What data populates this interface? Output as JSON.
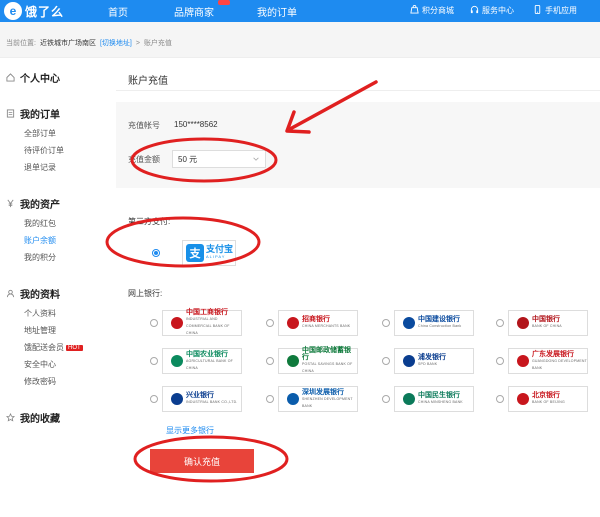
{
  "header": {
    "logo_text": "饿了么",
    "nav": [
      "首页",
      "品牌商家",
      "我的订单"
    ],
    "right": [
      "积分商城",
      "服务中心",
      "手机应用"
    ]
  },
  "breadcrumb": {
    "prefix": "当前位置:",
    "location": "近铁城市广场南区",
    "switch": "[切换地址]",
    "sep": ">",
    "current": "账户充值"
  },
  "sidebar": {
    "sections": [
      {
        "title": "个人中心",
        "icon": "home-icon",
        "items": []
      },
      {
        "title": "我的订单",
        "icon": "order-icon",
        "items": [
          "全部订单",
          "待评价订单",
          "退单记录"
        ]
      },
      {
        "title": "我的资产",
        "icon": "yen-icon",
        "items": [
          "我的红包",
          "账户余额",
          "我的积分"
        ]
      },
      {
        "title": "我的资料",
        "icon": "user-icon",
        "items": [
          "个人资料",
          "地址管理",
          "饿配送会员",
          "安全中心",
          "修改密码"
        ]
      },
      {
        "title": "我的收藏",
        "icon": "star-icon",
        "items": []
      }
    ],
    "active_item": "账户余额",
    "hot_badge": "HOT"
  },
  "main": {
    "title": "账户充值",
    "account_label": "充值帐号",
    "account_value": "150****8562",
    "amount_label": "充值金额",
    "amount_value": "50 元",
    "third_party_label": "第三方支付:",
    "alipay": {
      "cn": "支付宝",
      "en": "ALIPAY"
    },
    "online_bank_label": "网上银行:",
    "banks": [
      {
        "cn": "中国工商银行",
        "en": "INDUSTRIAL AND COMMERCIAL BANK OF CHINA",
        "color": "#c8161d"
      },
      {
        "cn": "招商银行",
        "en": "CHINA MERCHANTS BANK",
        "color": "#c8161d"
      },
      {
        "cn": "中国建设银行",
        "en": "China Construction Bank",
        "color": "#0a4a9e"
      },
      {
        "cn": "中国银行",
        "en": "BANK OF CHINA",
        "color": "#b2151b"
      },
      {
        "cn": "中国农业银行",
        "en": "AGRICULTURAL BANK OF CHINA",
        "color": "#0b8a5e"
      },
      {
        "cn": "中国邮政储蓄银行",
        "en": "POSTAL SAVINGS BANK OF CHINA",
        "color": "#0f7a3c"
      },
      {
        "cn": "浦发银行",
        "en": "SPD BANK",
        "color": "#0a3d8f"
      },
      {
        "cn": "广东发展银行",
        "en": "GUANGDONG DEVELOPMENT BANK",
        "color": "#c8161d"
      },
      {
        "cn": "兴业银行",
        "en": "INDUSTRIAL BANK CO.,LTD.",
        "color": "#0a3d8f"
      },
      {
        "cn": "深圳发展银行",
        "en": "SHENZHEN DEVELOPMENT BANK",
        "color": "#0a5cab"
      },
      {
        "cn": "中国民生银行",
        "en": "CHINA MINSHENG BANK",
        "color": "#0b7a5a"
      },
      {
        "cn": "北京银行",
        "en": "BANK OF BEIJING",
        "color": "#c8161d"
      }
    ],
    "more_banks": "显示更多银行",
    "confirm": "确认充值"
  },
  "colors": {
    "primary": "#1e8bf0",
    "confirm": "#e8443a",
    "annotation": "#e02020"
  }
}
